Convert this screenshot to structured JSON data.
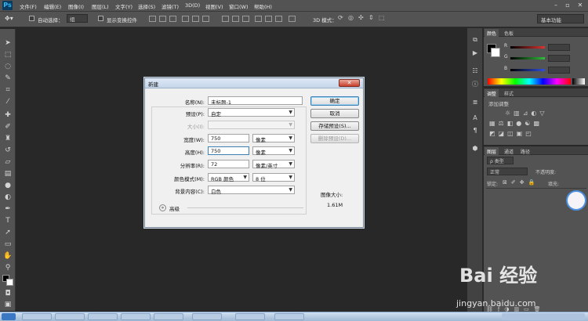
{
  "app": {
    "logo": "Ps"
  },
  "menu": [
    "文件(F)",
    "编辑(E)",
    "图像(I)",
    "图层(L)",
    "文字(Y)",
    "选择(S)",
    "滤镜(T)",
    "3D(D)",
    "视图(V)",
    "窗口(W)",
    "帮助(H)"
  ],
  "window_controls": {
    "minimize": "–",
    "restore": "▫",
    "close": "✕"
  },
  "options": {
    "auto_select_label": "自动选择：",
    "auto_select_value": "组",
    "show_transform_label": "显示变换控件",
    "mode_3d_label": "3D 模式：",
    "workspace": "基本功能"
  },
  "tools": [
    "move-tool-icon",
    "marquee-icon",
    "lasso-icon",
    "quick-select-icon",
    "crop-icon",
    "eyedropper-icon",
    "healing-brush-icon",
    "brush-icon",
    "clone-stamp-icon",
    "history-brush-icon",
    "eraser-icon",
    "gradient-icon",
    "blur-icon",
    "dodge-icon",
    "pen-icon",
    "type-icon",
    "path-select-icon",
    "shape-icon",
    "hand-icon",
    "zoom-icon"
  ],
  "color_panel": {
    "tabs": [
      "颜色",
      "色板"
    ],
    "channels": [
      "R",
      "G",
      "B"
    ],
    "channel_colors": [
      "#e0332f",
      "#2fbf3a",
      "#2f4fe0"
    ]
  },
  "adjust_panel": {
    "tabs": [
      "调整",
      "样式"
    ],
    "heading": "添加调整"
  },
  "layers_panel": {
    "tabs": [
      "图层",
      "通道",
      "路径"
    ],
    "kind_label": "ρ 类型",
    "blend_mode": "正常",
    "opacity_label": "不透明度:",
    "lock_label": "锁定:",
    "fill_label": "填充:"
  },
  "dialog": {
    "title": "新建",
    "close": "✕",
    "name_label": "名称(N):",
    "name_value": "未标题-1",
    "preset_label": "预设(P):",
    "preset_value": "自定",
    "size_label": "大小(I):",
    "size_value": "",
    "width_label": "宽度(W):",
    "width_value": "750",
    "width_unit": "像素",
    "height_label": "高度(H):",
    "height_value": "750",
    "height_unit": "像素",
    "resolution_label": "分辨率(R):",
    "resolution_value": "72",
    "resolution_unit": "像素/英寸",
    "color_mode_label": "颜色模式(M):",
    "color_mode_value": "RGB 颜色",
    "bit_depth_value": "8 位",
    "background_label": "背景内容(C):",
    "background_value": "白色",
    "advanced_label": "高级",
    "ok_button": "确定",
    "cancel_button": "取消",
    "save_preset_button": "存储预设(S)...",
    "delete_preset_button": "删除预设(D)...",
    "image_size_label": "图像大小:",
    "image_size_value": "1.61M"
  },
  "watermark": {
    "brand": "Bai 经验",
    "url": "jingyan.baidu.com"
  }
}
